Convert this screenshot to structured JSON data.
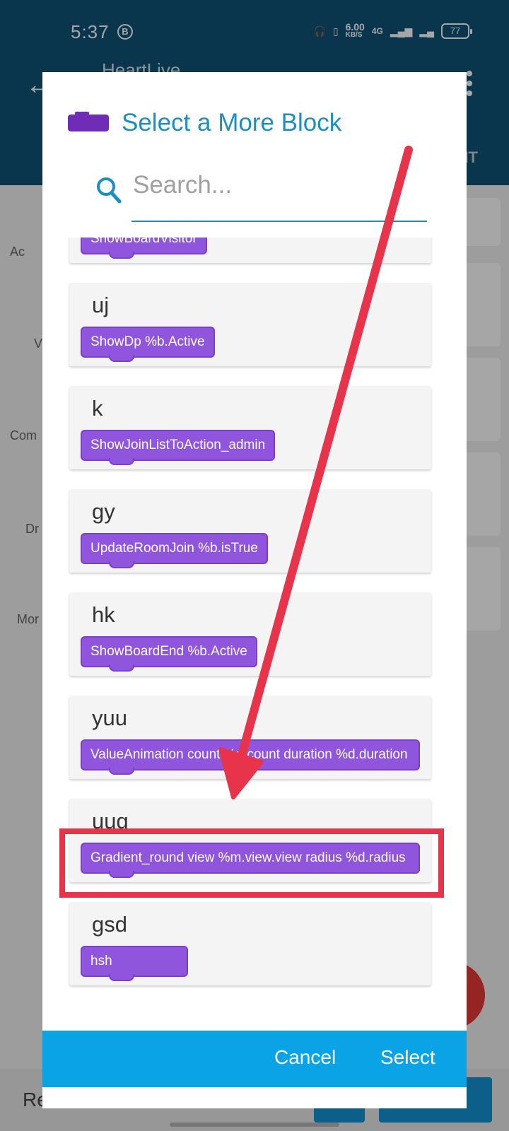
{
  "status_bar": {
    "time": "5:37",
    "b_badge": "B",
    "speed": "6.00",
    "speed_unit": "KB/S",
    "network": "4G",
    "battery": "77"
  },
  "app_bar": {
    "title": "HeartLive",
    "right_text": "IT"
  },
  "background": {
    "side_items": [
      "Ac",
      "V",
      "Com",
      "Dr",
      "Mor"
    ],
    "bottom_text": "Re"
  },
  "dialog": {
    "title": "Select a More Block",
    "search_placeholder": "Search...",
    "search_value": "",
    "items": [
      {
        "name": "",
        "block": "ShowBoardVisitor"
      },
      {
        "name": "uj",
        "block": "ShowDp %b.Active"
      },
      {
        "name": "k",
        "block": "ShowJoinListToAction_admin"
      },
      {
        "name": "gy",
        "block": "UpdateRoomJoin %b.isTrue"
      },
      {
        "name": "hk",
        "block": "ShowBoardEnd %b.Active"
      },
      {
        "name": "yuu",
        "block": "ValueAnimation count %d.count duration %d.duration"
      },
      {
        "name": "uug",
        "block": "Gradient_round view %m.view.view radius %d.radius"
      },
      {
        "name": "gsd",
        "block": "hsh"
      }
    ],
    "cancel_label": "Cancel",
    "select_label": "Select"
  },
  "colors": {
    "app_bar": "#0f5476",
    "accent": "#1a8fc1",
    "block_purple": "#8f55dd",
    "footer_blue": "#0aa4e6",
    "annotation_red": "#e8344a"
  }
}
